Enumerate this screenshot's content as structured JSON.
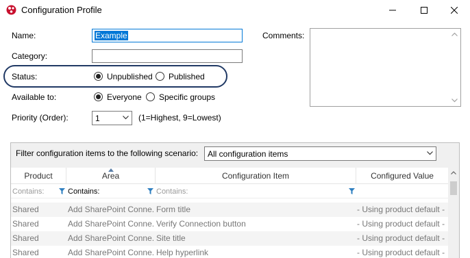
{
  "window": {
    "title": "Configuration Profile",
    "icon": "app-logo-icon"
  },
  "form": {
    "name_label": "Name:",
    "name_value": "Example",
    "category_label": "Category:",
    "category_value": "",
    "status_label": "Status:",
    "status_options": [
      "Unpublished",
      "Published"
    ],
    "status_selected": "Unpublished",
    "available_label": "Available to:",
    "available_options": [
      "Everyone",
      "Specific groups"
    ],
    "available_selected": "Everyone",
    "priority_label": "Priority (Order):",
    "priority_value": "1",
    "priority_hint": "(1=Highest, 9=Lowest)",
    "comments_label": "Comments:",
    "comments_value": ""
  },
  "filter": {
    "label": "Filter configuration items to the following scenario:",
    "selected": "All configuration items"
  },
  "grid": {
    "columns": [
      "Product",
      "Area",
      "Configuration Item",
      "Configured Value"
    ],
    "filter_row": {
      "product": "Contains:",
      "area": "Contains:",
      "item": "Contains:"
    },
    "rows": [
      {
        "product": "Shared",
        "area": "Add SharePoint Conne...",
        "item": "Form title",
        "value": "- Using product default -"
      },
      {
        "product": "Shared",
        "area": "Add SharePoint Conne...",
        "item": "Verify Connection button",
        "value": "- Using product default -"
      },
      {
        "product": "Shared",
        "area": "Add SharePoint Conne...",
        "item": "Site title",
        "value": "- Using product default -"
      },
      {
        "product": "Shared",
        "area": "Add SharePoint Conne...",
        "item": "Help hyperlink",
        "value": "- Using product default -"
      }
    ]
  },
  "colors": {
    "accent": "#0078d7",
    "highlight_oval": "#1f3864",
    "filter_icon": "#2e7fc0"
  }
}
